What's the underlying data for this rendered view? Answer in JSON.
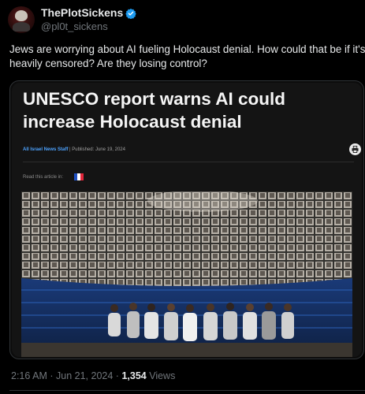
{
  "author": {
    "display_name": "ThePlotSickens",
    "handle": "@pl0t_sickens"
  },
  "post": {
    "text": "Jews are worrying about AI fueling Holocaust denial. How could that be if it's so heavily censored? Are they losing control?"
  },
  "article": {
    "headline": "UNESCO report warns AI could increase Holocaust denial",
    "author": "All Israel News Staff",
    "published": "| Published: June 19, 2024",
    "read_in": "Read this article in:",
    "image_alt": "Hall of Names ceiling with portraits above a group of people in a circle"
  },
  "meta": {
    "time": "2:16 AM",
    "date": "Jun 21, 2024",
    "views_count": "1,354",
    "views_label": "Views",
    "sep": "·"
  },
  "colors": {
    "background": "#000000",
    "text": "#e7e9ea",
    "muted": "#71767b",
    "verified": "#1d9bf0",
    "link": "#4da3ff"
  }
}
